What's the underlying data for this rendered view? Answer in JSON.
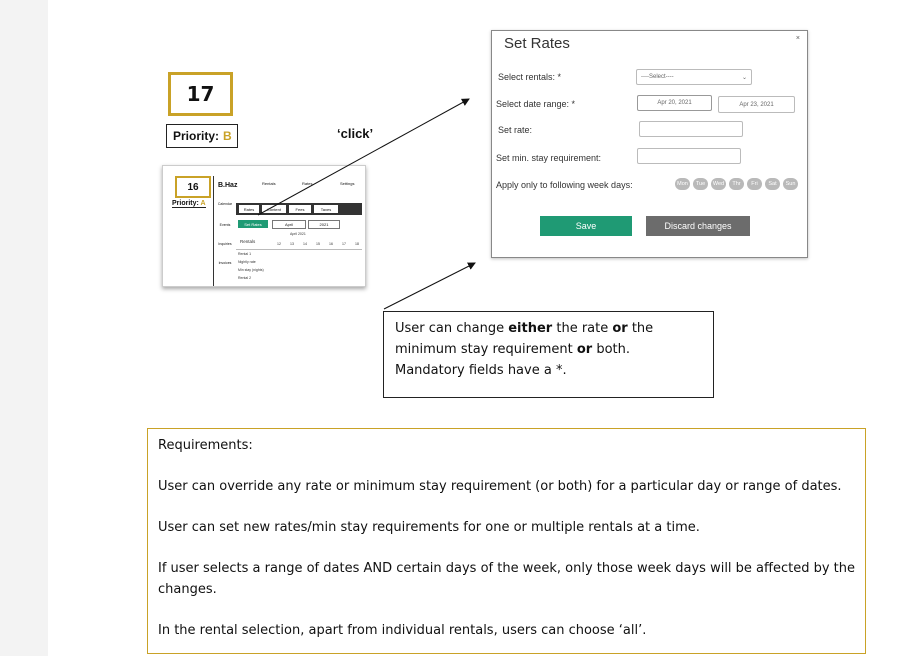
{
  "story": {
    "number": "17",
    "priority_label": "Priority:",
    "priority_value": "B"
  },
  "click_label": "‘click’",
  "thumbnail": {
    "story_number": "16",
    "priority_label": "Priority:",
    "priority_value": "A",
    "brand": "B.Haz",
    "nav": [
      "Rentals",
      "Rates",
      "Settings"
    ],
    "sidebar": [
      "Calendar",
      "Events",
      "Inquiries",
      "Invoices"
    ],
    "tabs": [
      "Rates",
      "Content",
      "Fees",
      "Taxes"
    ],
    "set_rates_button": "Set Rates",
    "month": "April",
    "year": "2021",
    "period": "April 2021",
    "row_labels": [
      "Rentals",
      "Rental 1",
      "Nightly rate",
      "Min stay (nights)",
      "Rental 2"
    ],
    "days": [
      "12",
      "13",
      "14",
      "15",
      "16",
      "17",
      "18"
    ]
  },
  "modal": {
    "title": "Set Rates",
    "close": "×",
    "labels": {
      "rentals": "Select rentals: *",
      "date_range": "Select date range: *",
      "rate": "Set rate:",
      "min_stay": "Set min. stay requirement:",
      "weekdays": "Apply only to following week days:"
    },
    "rentals_select": "----Select----",
    "date_from": "Apr 20, 2021",
    "date_to": "Apr 23, 2021",
    "days": [
      "Mon",
      "Tue",
      "Wed",
      "Thr",
      "Fri",
      "Sat",
      "Sun"
    ],
    "save_label": "Save",
    "discard_label": "Discard changes"
  },
  "callout": {
    "t1": "User can change ",
    "b1": "either",
    "t2": " the rate ",
    "b2": "or",
    "t3": " the minimum stay requirement ",
    "b3": "or",
    "t4": " both. Mandatory fields have a *."
  },
  "requirements": {
    "heading": "Requirements:",
    "items": [
      "User can override any rate or minimum stay requirement (or both) for a particular day or range of dates.",
      "User can set new rates/min stay requirements for one or multiple rentals at a time.",
      "If user selects a range of dates AND certain days of the week, only those week days will be affected by the changes.",
      "In the rental selection, apart from individual rentals, users can choose ‘all’."
    ]
  }
}
